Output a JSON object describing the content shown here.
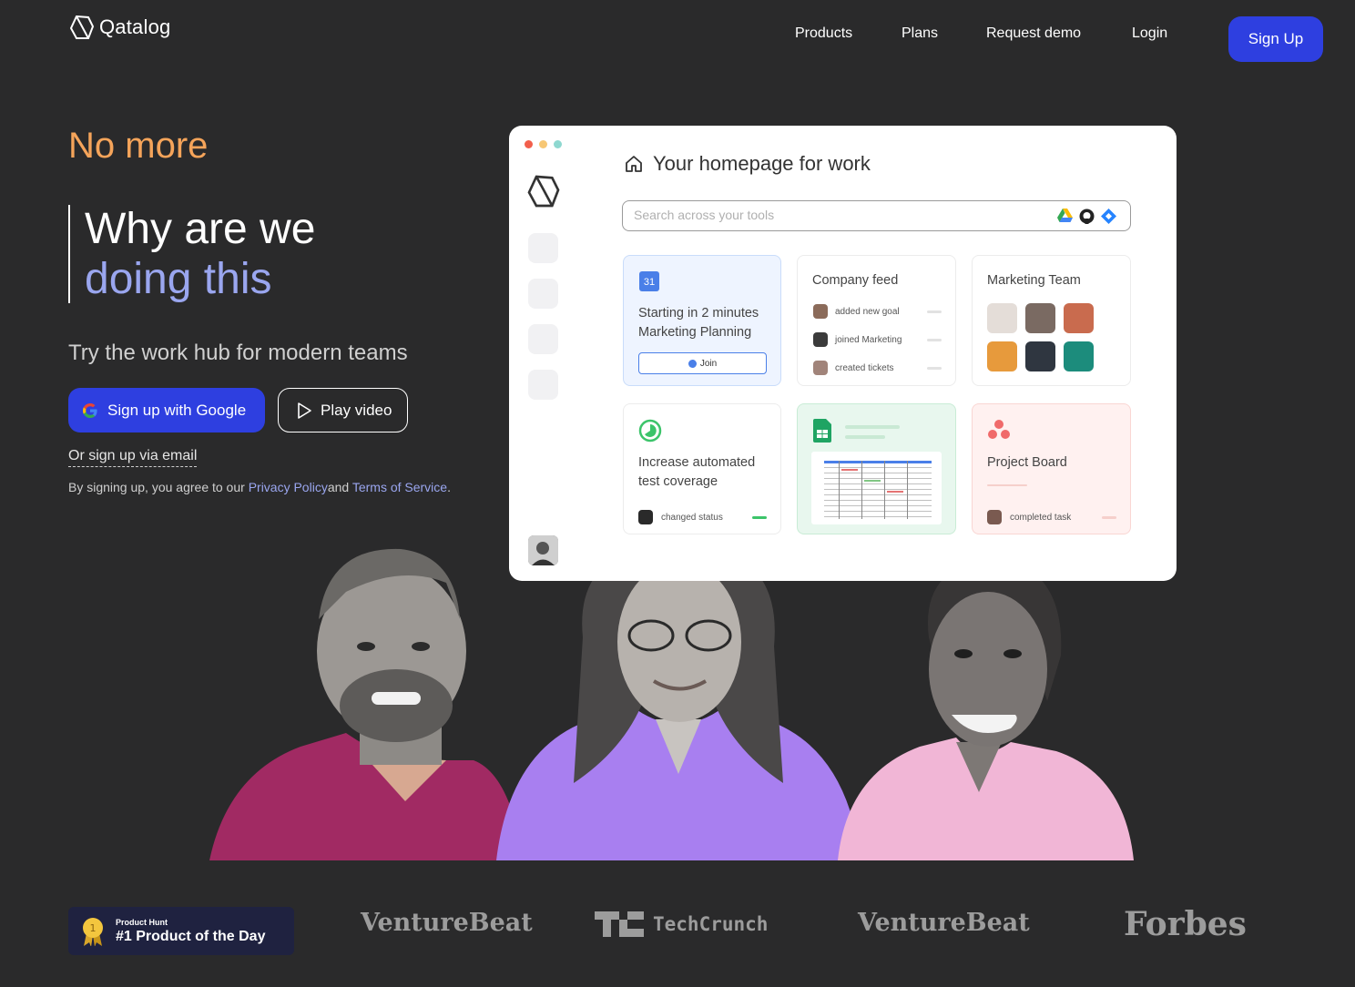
{
  "nav": {
    "logo_text": "Qatalog",
    "links": [
      "Products",
      "Plans",
      "Request demo",
      "Login"
    ],
    "signup_label": "Sign Up"
  },
  "hero": {
    "eyebrow": "No more",
    "headline_line1": "Why are we",
    "headline_line2": "doing this",
    "tagline": "Try the work hub for modern teams",
    "google_button": "Sign up with Google",
    "video_button": "Play video",
    "email_link": "Or sign up via email",
    "legal_prefix": "By signing up, you agree to our ",
    "privacy_link": "Privacy Policy",
    "legal_and": "and ",
    "terms_link": "Terms of Service",
    "legal_suffix": "."
  },
  "app": {
    "title": "Your homepage for work",
    "search_placeholder": "Search across your tools",
    "meeting_card": {
      "date": "31",
      "line1": "Starting in 2 minutes",
      "line2": "Marketing Planning",
      "join_label": "Join"
    },
    "feed_card": {
      "title": "Company feed",
      "items": [
        "added new goal",
        "joined Marketing",
        "created tickets"
      ]
    },
    "team_card": {
      "title": "Marketing Team"
    },
    "coverage_card": {
      "line1": "Increase automated",
      "line2": "test coverage",
      "status": "changed status"
    },
    "board_card": {
      "title": "Project Board",
      "status": "completed task"
    }
  },
  "press": {
    "ph_small": "Product Hunt",
    "ph_big": "#1 Product of the Day",
    "ph_medal": "1",
    "logos": [
      "VentureBeat",
      "TechCrunch",
      "VentureBeat",
      "Forbes"
    ]
  },
  "colors": {
    "background": "#2a2a2b",
    "accent_blue": "#2e3fe0",
    "eyebrow_orange": "#f5a45a",
    "headline_lavender": "#9aa6ef"
  }
}
